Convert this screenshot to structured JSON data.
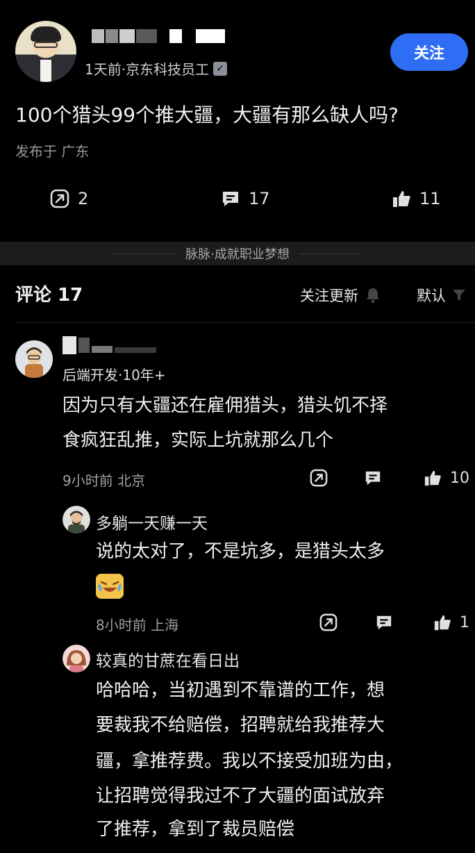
{
  "post": {
    "meta": "1天前·京东科技员工",
    "verify_glyph": "✓",
    "follow_label": "关注",
    "title": "100个猎头99个推大疆，大疆有那么缺人吗?",
    "location": "发布于 广东",
    "actions": {
      "share_count": "2",
      "comment_count": "17",
      "like_count": "11"
    }
  },
  "brand_bar": {
    "text": "脉脉·成就职业梦想"
  },
  "comments_header": {
    "title": "评论 17",
    "follow_updates": "关注更新",
    "sort": "默认"
  },
  "comments": [
    {
      "author_meta": "后端开发·10年+",
      "lines": [
        "因为只有大疆还在雇佣猎头，猎头饥不择",
        "食疯狂乱推，实际上坑就那么几个"
      ],
      "time_location": "9小时前  北京",
      "like_count": "10"
    }
  ],
  "replies": [
    {
      "name": "多躺一天赚一天",
      "lines": [
        "说的太对了，不是坑多，是猎头太多"
      ],
      "time_location": "8小时前  上海",
      "like_count": "1"
    },
    {
      "name": "较真的甘蔗在看日出",
      "lines": [
        "哈哈哈，当初遇到不靠谱的工作，想",
        "要裁我不给赔偿，招聘就给我推荐大",
        "疆，拿推荐费。我以不接受加班为由，",
        "让招聘觉得我过不了大疆的面试放弃",
        "了推荐，拿到了裁员赔偿"
      ]
    }
  ],
  "colors": {
    "accent": "#2f6ef4",
    "background": "#000000",
    "brand_bar": "#1c1c1c"
  }
}
